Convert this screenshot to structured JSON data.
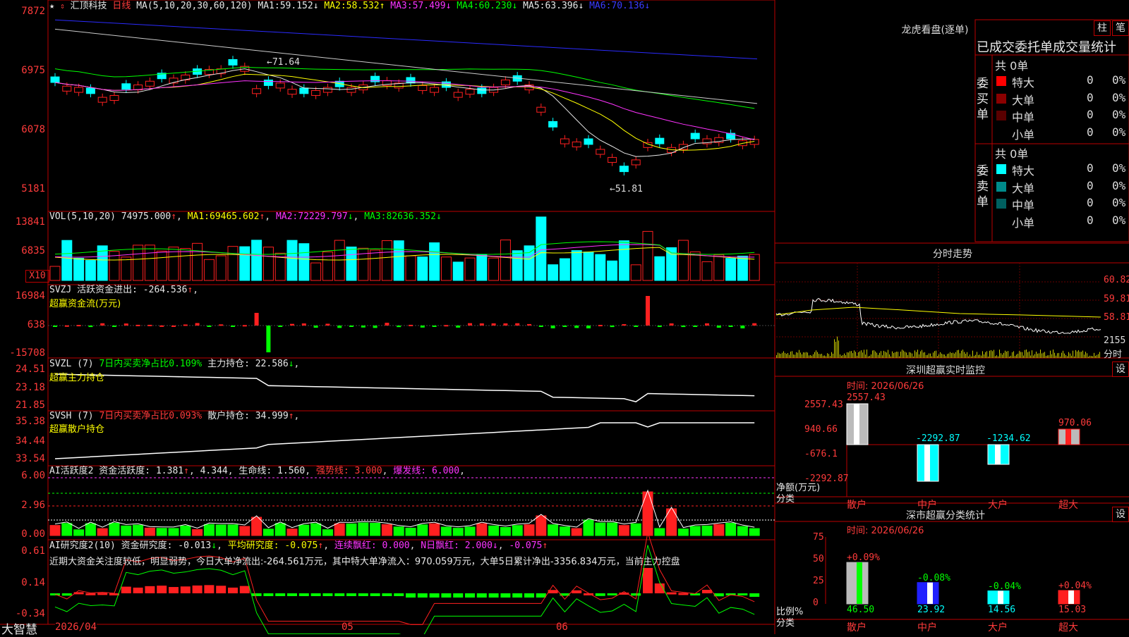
{
  "app": {
    "brand": "大智慧"
  },
  "kline": {
    "name": "汇顶科技",
    "period": "日线",
    "ma_params": "MA(5,10,20,30,60,120)",
    "ma": [
      {
        "label": "MA1:",
        "value": "59.152",
        "arrow": "↓",
        "color": "#e8e8e8"
      },
      {
        "label": "MA2:",
        "value": "58.532",
        "arrow": "↑",
        "color": "#ffff00"
      },
      {
        "label": "MA3:",
        "value": "57.499",
        "arrow": "↓",
        "color": "#ff33ff"
      },
      {
        "label": "MA4:",
        "value": "60.230",
        "arrow": "↓",
        "color": "#00ff00"
      },
      {
        "label": "MA5:",
        "value": "63.396",
        "arrow": "↓",
        "color": "#e8e8e8"
      },
      {
        "label": "MA6:",
        "value": "70.136",
        "arrow": "↓",
        "color": "#3b3bff"
      }
    ],
    "y_labels": [
      "7872",
      "6975",
      "6078",
      "5181"
    ],
    "high_mark": "71.64",
    "low_mark": "51.81"
  },
  "vol": {
    "header": "VOL(5,10,20)",
    "value": "74975.000",
    "value_arrow": "↑",
    "ma": [
      {
        "label": "MA1:",
        "value": "69465.602",
        "arrow": "↑",
        "color": "#ffff00"
      },
      {
        "label": "MA2:",
        "value": "72229.797",
        "arrow": "↓",
        "color": "#ff33ff"
      },
      {
        "label": "MA3:",
        "value": "82636.352",
        "arrow": "↓",
        "color": "#00ff00"
      }
    ],
    "y_labels": [
      "13841",
      "6835"
    ],
    "unit": "X10"
  },
  "svzj": {
    "header": "SVZJ  活跃资金进出:",
    "value": "-264.536",
    "arrow": "↑",
    "subtitle": "超赢资金流(万元)",
    "y_labels": [
      "16984",
      "638",
      "-15708"
    ]
  },
  "svzl": {
    "header": "SVZL (7)",
    "ratio_text": "7日内买卖净占比0.109%",
    "hold_label": "主力持仓:",
    "hold_value": "22.586",
    "hold_arrow": "↓",
    "subtitle": "超赢主力持仓",
    "y_labels": [
      "24.51",
      "23.18",
      "21.85"
    ]
  },
  "svsh": {
    "header": "SVSH (7)",
    "ratio_text": "7日内买卖净占比0.093%",
    "hold_label": "散户持仓:",
    "hold_value": "34.999",
    "hold_arrow": "↑",
    "subtitle": "超赢散户持仓",
    "y_labels": [
      "35.38",
      "34.44",
      "33.54"
    ]
  },
  "ai_active": {
    "header": "AI活跃度2 资金活跃度:",
    "value": "1.381",
    "value2": "4.344",
    "life_label": "生命线:",
    "life_value": "1.560",
    "strong_label": "强势线:",
    "strong_value": "3.000",
    "burst_label": "爆发线:",
    "burst_value": "6.000",
    "y_labels": [
      "6.00",
      "2.96",
      "0.00"
    ]
  },
  "ai_research": {
    "header": "AI研究度2(10)",
    "r_label": "资金研究度:",
    "r_value": "-0.013",
    "avg_label": "平均研究度:",
    "avg_value": "-0.075",
    "lh_label": "连续飘红:",
    "lh_value": "0.000",
    "nh_label": "N日飘红:",
    "nh_value": "2.000",
    "extra_value": "-0.075",
    "comment": "近期大资金关注度较低，明显弱势，今日大单净流出:-264.561万元，其中特大单净流入：970.059万元，大单5日累计净出-3356.834万元，当前主力控盘",
    "y_labels": [
      "0.61",
      "0.14",
      "-0.34"
    ]
  },
  "xaxis": {
    "labels": [
      "2026/04",
      "05",
      "06"
    ]
  },
  "lhb": {
    "title": "龙虎看盘(逐单)",
    "btn1": "柱",
    "btn2": "笔",
    "header": "已成交委托单成交量统计",
    "buy": {
      "side_label": "委买单",
      "total": "共 0单",
      "rows": [
        {
          "label": "特大",
          "count": "0",
          "pct": "0%",
          "color": "#ff0000"
        },
        {
          "label": "大单",
          "count": "0",
          "pct": "0%",
          "color": "#8b0000"
        },
        {
          "label": "中单",
          "count": "0",
          "pct": "0%",
          "color": "#5a0000"
        },
        {
          "label": "小单",
          "count": "0",
          "pct": "0%",
          "color": ""
        }
      ]
    },
    "sell": {
      "side_label": "委卖单",
      "total": "共 0单",
      "rows": [
        {
          "label": "特大",
          "count": "0",
          "pct": "0%",
          "color": "#00ffff"
        },
        {
          "label": "大单",
          "count": "0",
          "pct": "0%",
          "color": "#008b8b"
        },
        {
          "label": "中单",
          "count": "0",
          "pct": "0%",
          "color": "#006060"
        },
        {
          "label": "小单",
          "count": "0",
          "pct": "0%",
          "color": ""
        }
      ]
    }
  },
  "intraday": {
    "title": "分时走势",
    "y_labels": [
      "60.82",
      "59.81",
      "58.81"
    ],
    "vol_label": "2155",
    "unit": "分时"
  },
  "sz_monitor": {
    "title": "深圳超赢实时监控",
    "btn": "设",
    "date": "时间: 2026/06/26",
    "y_labels": [
      "2557.43",
      "940.66",
      "-676.1",
      "-2292.87"
    ],
    "y_caption": "净额(万元)",
    "x_caption": "分类",
    "bars": [
      {
        "category": "散户",
        "value": 2557.43,
        "label": "2557.43"
      },
      {
        "category": "中户",
        "value": -2292.87,
        "label": "-2292.87"
      },
      {
        "category": "大户",
        "value": -1234.62,
        "label": "-1234.62"
      },
      {
        "category": "超大",
        "value": 970.06,
        "label": "970.06"
      }
    ]
  },
  "sz_class": {
    "title": "深市超赢分类统计",
    "btn": "设",
    "date": "时间: 2026/06/26",
    "y_labels": [
      "75",
      "50",
      "25",
      "0"
    ],
    "y_caption": "比例%",
    "x_caption": "分类",
    "bars": [
      {
        "category": "散户",
        "value": 46.5,
        "label": "46.50",
        "delta": "+0.09%"
      },
      {
        "category": "中户",
        "value": 23.92,
        "label": "23.92",
        "delta": "-0.08%"
      },
      {
        "category": "大户",
        "value": 14.56,
        "label": "14.56",
        "delta": "-0.04%"
      },
      {
        "category": "超大",
        "value": 15.03,
        "label": "15.03",
        "delta": "+0.04%"
      }
    ]
  }
}
